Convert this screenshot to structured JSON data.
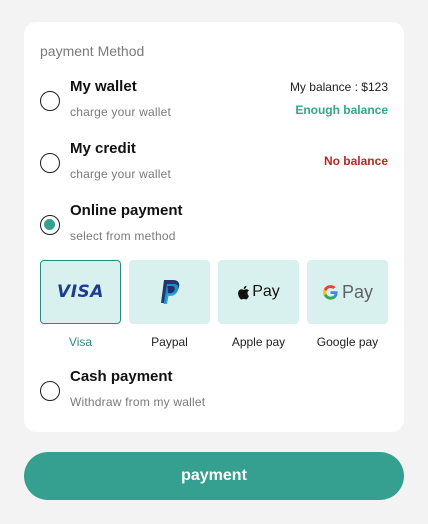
{
  "section_title": "payment Method",
  "options": [
    {
      "title": "My wallet",
      "subtitle": "charge your wallet",
      "balance_label": "My balance : $123",
      "status": "Enough balance",
      "selected": false
    },
    {
      "title": "My credit",
      "subtitle": "charge your wallet",
      "status": "No balance",
      "selected": false
    },
    {
      "title": "Online payment",
      "subtitle": "select from method",
      "selected": true
    },
    {
      "title": "Cash payment",
      "subtitle": "Withdraw from my wallet",
      "selected": false
    }
  ],
  "methods": [
    {
      "label": "Visa",
      "logo": "VISA",
      "icon": "visa-logo",
      "selected": true
    },
    {
      "label": "Paypal",
      "logo": "P",
      "icon": "paypal-logo",
      "selected": false
    },
    {
      "label": "Apple pay",
      "logo": "Pay",
      "icon": "apple-pay-logo",
      "selected": false
    },
    {
      "label": "Google pay",
      "logo": "Pay",
      "icon": "google-pay-logo",
      "selected": false
    }
  ],
  "pay_button_label": "payment",
  "colors": {
    "accent": "#35a08f",
    "method_bg": "#d9f1ee",
    "ok": "#2faa82",
    "error": "#b32b20"
  }
}
